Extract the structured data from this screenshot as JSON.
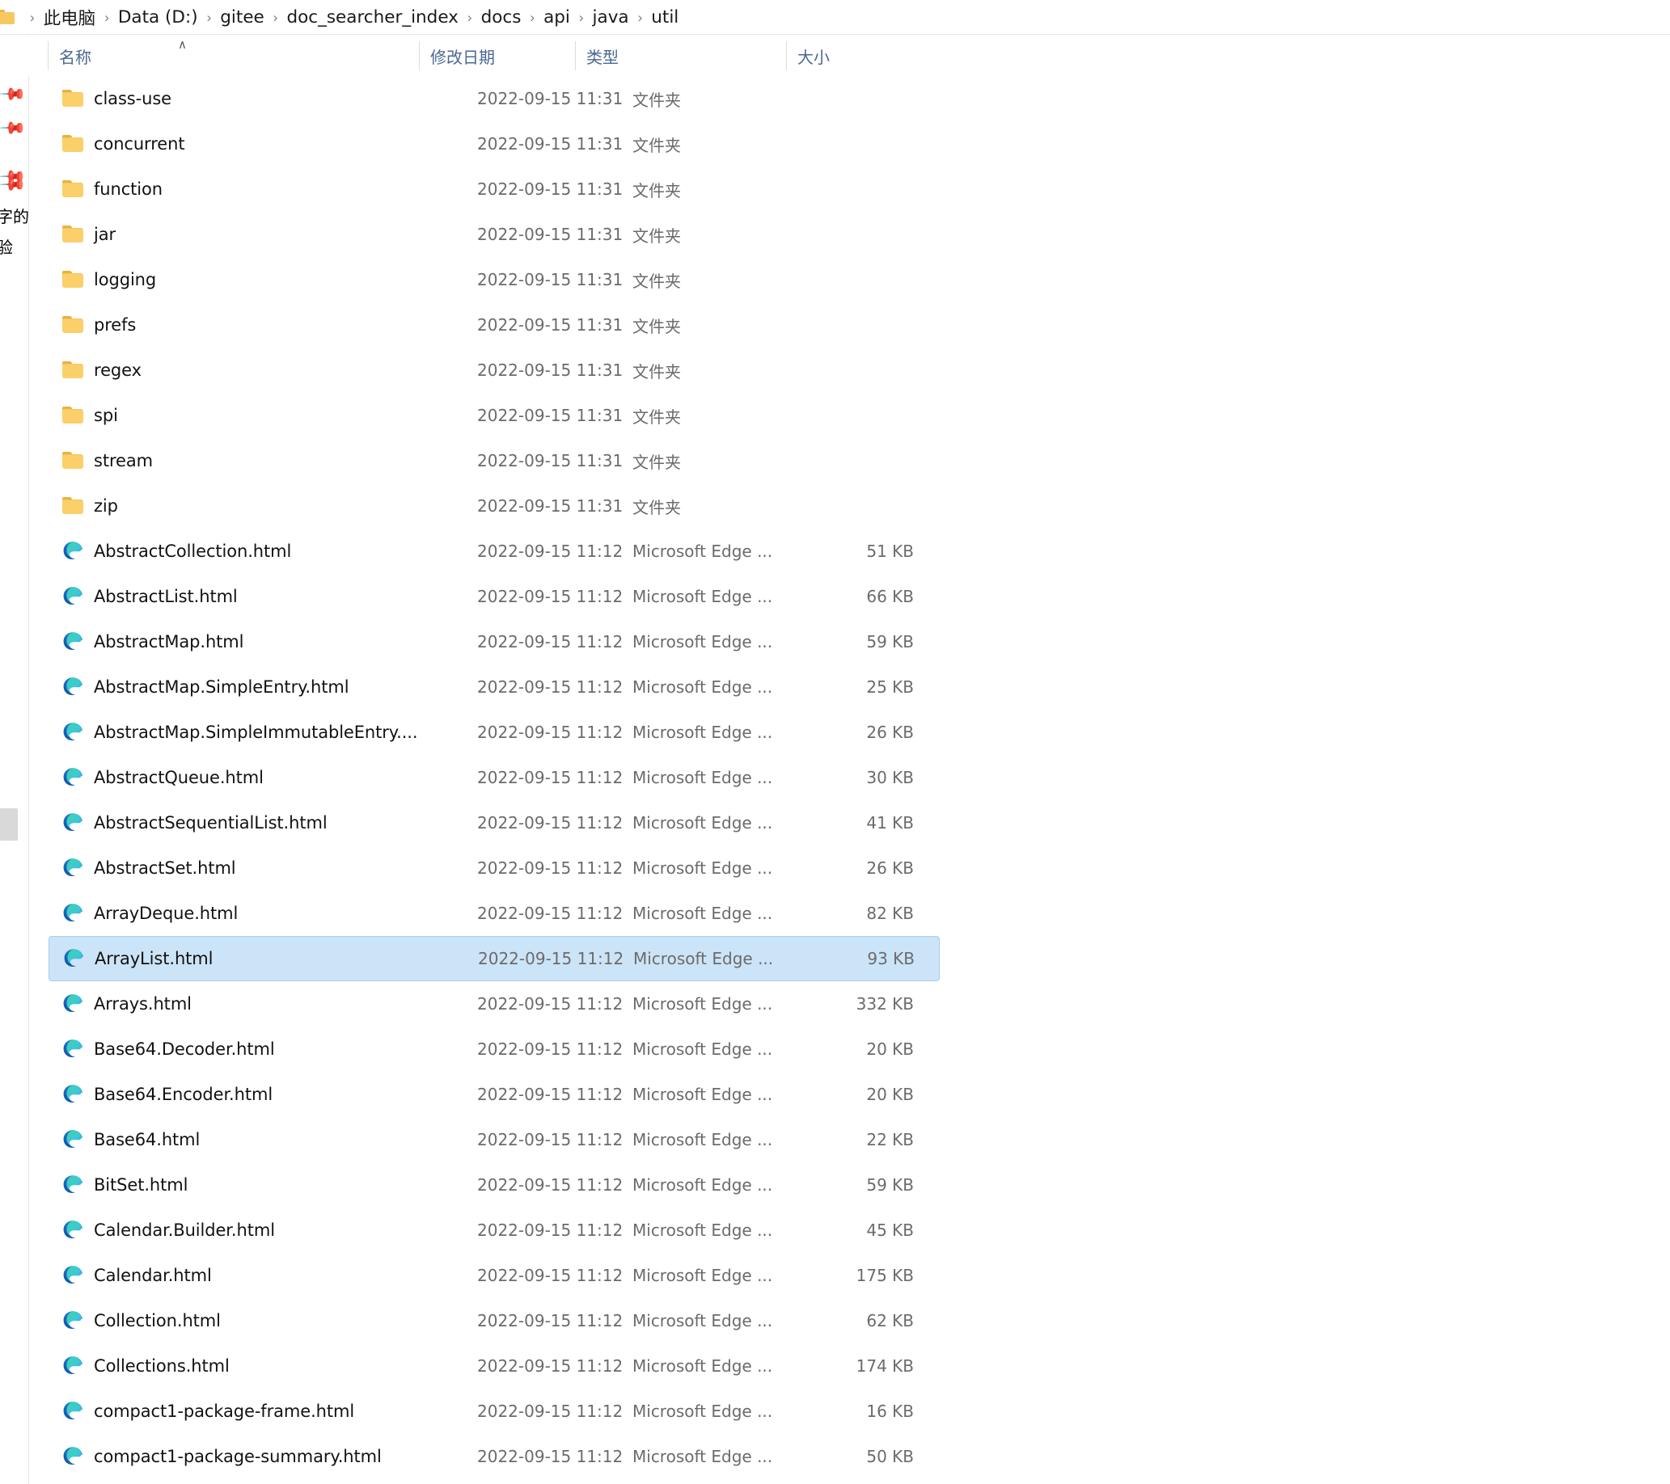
{
  "window": {
    "title": "util",
    "accent_selection_color": "#cce4f7",
    "header_text_color": "#4c6792"
  },
  "breadcrumb": {
    "folder_icon": "folder-icon",
    "separator": "›",
    "items": [
      {
        "label": "此电脑"
      },
      {
        "label": "Data (D:)"
      },
      {
        "label": "gitee"
      },
      {
        "label": "doc_searcher_index"
      },
      {
        "label": "docs"
      },
      {
        "label": "api"
      },
      {
        "label": "java"
      },
      {
        "label": "util"
      }
    ]
  },
  "left_rail": {
    "pins": [
      "pin-icon",
      "pin-icon",
      "pin-icon",
      "pin-icon"
    ],
    "clipped_labels": [
      "字的",
      "验"
    ],
    "scrollbar": "vertical-scrollbar-thumb"
  },
  "columns": {
    "headers": [
      {
        "key": "name",
        "label": "名称",
        "sorted": true,
        "sort_caret": "∧"
      },
      {
        "key": "date",
        "label": "修改日期",
        "sorted": false
      },
      {
        "key": "type",
        "label": "类型",
        "sorted": false
      },
      {
        "key": "size",
        "label": "大小",
        "sorted": false
      }
    ]
  },
  "files": [
    {
      "name": "class-use",
      "date": "2022-09-15 11:31",
      "type": "文件夹",
      "size": "",
      "icon": "folder-icon",
      "selected": false
    },
    {
      "name": "concurrent",
      "date": "2022-09-15 11:31",
      "type": "文件夹",
      "size": "",
      "icon": "folder-icon",
      "selected": false
    },
    {
      "name": "function",
      "date": "2022-09-15 11:31",
      "type": "文件夹",
      "size": "",
      "icon": "folder-icon",
      "selected": false
    },
    {
      "name": "jar",
      "date": "2022-09-15 11:31",
      "type": "文件夹",
      "size": "",
      "icon": "folder-icon",
      "selected": false
    },
    {
      "name": "logging",
      "date": "2022-09-15 11:31",
      "type": "文件夹",
      "size": "",
      "icon": "folder-icon",
      "selected": false
    },
    {
      "name": "prefs",
      "date": "2022-09-15 11:31",
      "type": "文件夹",
      "size": "",
      "icon": "folder-icon",
      "selected": false
    },
    {
      "name": "regex",
      "date": "2022-09-15 11:31",
      "type": "文件夹",
      "size": "",
      "icon": "folder-icon",
      "selected": false
    },
    {
      "name": "spi",
      "date": "2022-09-15 11:31",
      "type": "文件夹",
      "size": "",
      "icon": "folder-icon",
      "selected": false
    },
    {
      "name": "stream",
      "date": "2022-09-15 11:31",
      "type": "文件夹",
      "size": "",
      "icon": "folder-icon",
      "selected": false
    },
    {
      "name": "zip",
      "date": "2022-09-15 11:31",
      "type": "文件夹",
      "size": "",
      "icon": "folder-icon",
      "selected": false
    },
    {
      "name": "AbstractCollection.html",
      "date": "2022-09-15 11:12",
      "type": "Microsoft Edge ...",
      "size": "51 KB",
      "icon": "edge-icon",
      "selected": false
    },
    {
      "name": "AbstractList.html",
      "date": "2022-09-15 11:12",
      "type": "Microsoft Edge ...",
      "size": "66 KB",
      "icon": "edge-icon",
      "selected": false
    },
    {
      "name": "AbstractMap.html",
      "date": "2022-09-15 11:12",
      "type": "Microsoft Edge ...",
      "size": "59 KB",
      "icon": "edge-icon",
      "selected": false
    },
    {
      "name": "AbstractMap.SimpleEntry.html",
      "date": "2022-09-15 11:12",
      "type": "Microsoft Edge ...",
      "size": "25 KB",
      "icon": "edge-icon",
      "selected": false
    },
    {
      "name": "AbstractMap.SimpleImmutableEntry....",
      "date": "2022-09-15 11:12",
      "type": "Microsoft Edge ...",
      "size": "26 KB",
      "icon": "edge-icon",
      "selected": false
    },
    {
      "name": "AbstractQueue.html",
      "date": "2022-09-15 11:12",
      "type": "Microsoft Edge ...",
      "size": "30 KB",
      "icon": "edge-icon",
      "selected": false
    },
    {
      "name": "AbstractSequentialList.html",
      "date": "2022-09-15 11:12",
      "type": "Microsoft Edge ...",
      "size": "41 KB",
      "icon": "edge-icon",
      "selected": false
    },
    {
      "name": "AbstractSet.html",
      "date": "2022-09-15 11:12",
      "type": "Microsoft Edge ...",
      "size": "26 KB",
      "icon": "edge-icon",
      "selected": false
    },
    {
      "name": "ArrayDeque.html",
      "date": "2022-09-15 11:12",
      "type": "Microsoft Edge ...",
      "size": "82 KB",
      "icon": "edge-icon",
      "selected": false
    },
    {
      "name": "ArrayList.html",
      "date": "2022-09-15 11:12",
      "type": "Microsoft Edge ...",
      "size": "93 KB",
      "icon": "edge-icon",
      "selected": true
    },
    {
      "name": "Arrays.html",
      "date": "2022-09-15 11:12",
      "type": "Microsoft Edge ...",
      "size": "332 KB",
      "icon": "edge-icon",
      "selected": false
    },
    {
      "name": "Base64.Decoder.html",
      "date": "2022-09-15 11:12",
      "type": "Microsoft Edge ...",
      "size": "20 KB",
      "icon": "edge-icon",
      "selected": false
    },
    {
      "name": "Base64.Encoder.html",
      "date": "2022-09-15 11:12",
      "type": "Microsoft Edge ...",
      "size": "20 KB",
      "icon": "edge-icon",
      "selected": false
    },
    {
      "name": "Base64.html",
      "date": "2022-09-15 11:12",
      "type": "Microsoft Edge ...",
      "size": "22 KB",
      "icon": "edge-icon",
      "selected": false
    },
    {
      "name": "BitSet.html",
      "date": "2022-09-15 11:12",
      "type": "Microsoft Edge ...",
      "size": "59 KB",
      "icon": "edge-icon",
      "selected": false
    },
    {
      "name": "Calendar.Builder.html",
      "date": "2022-09-15 11:12",
      "type": "Microsoft Edge ...",
      "size": "45 KB",
      "icon": "edge-icon",
      "selected": false
    },
    {
      "name": "Calendar.html",
      "date": "2022-09-15 11:12",
      "type": "Microsoft Edge ...",
      "size": "175 KB",
      "icon": "edge-icon",
      "selected": false
    },
    {
      "name": "Collection.html",
      "date": "2022-09-15 11:12",
      "type": "Microsoft Edge ...",
      "size": "62 KB",
      "icon": "edge-icon",
      "selected": false
    },
    {
      "name": "Collections.html",
      "date": "2022-09-15 11:12",
      "type": "Microsoft Edge ...",
      "size": "174 KB",
      "icon": "edge-icon",
      "selected": false
    },
    {
      "name": "compact1-package-frame.html",
      "date": "2022-09-15 11:12",
      "type": "Microsoft Edge ...",
      "size": "16 KB",
      "icon": "edge-icon",
      "selected": false
    },
    {
      "name": "compact1-package-summary.html",
      "date": "2022-09-15 11:12",
      "type": "Microsoft Edge ...",
      "size": "50 KB",
      "icon": "edge-icon",
      "selected": false
    }
  ]
}
